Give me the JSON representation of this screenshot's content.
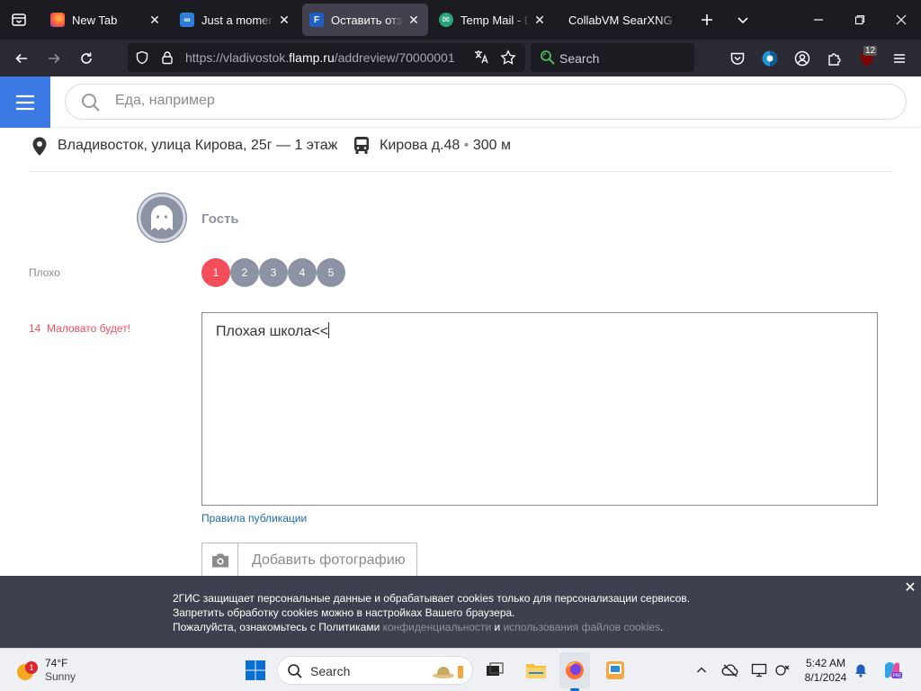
{
  "browser": {
    "tabs": [
      {
        "title": "New Tab",
        "favicon": "firefox-icon"
      },
      {
        "title": "Just a moment...",
        "favicon": "link-icon"
      },
      {
        "title": "Оставить отзыв",
        "favicon": "flamp-icon"
      },
      {
        "title": "Temp Mail - Disposable",
        "favicon": "tempmail-icon"
      },
      {
        "title": "CollabVM SearXNG",
        "favicon": ""
      }
    ],
    "url": {
      "prefix": "https://vladivostok.",
      "host": "flamp.ru",
      "path": "/addreview/70000001"
    },
    "search_placeholder": "Search",
    "extension_badge": "12"
  },
  "site": {
    "search_placeholder": "Еда, например",
    "address": "Владивосток, улица Кирова, 25г — 1 этаж",
    "transit_stop": "Кирова д.48",
    "transit_separator": "•",
    "transit_distance": "300 м",
    "user_name": "Гость",
    "rating_label": "Плохо",
    "rating_values": [
      "1",
      "2",
      "3",
      "4",
      "5"
    ],
    "rating_selected": 1,
    "char_count": "14",
    "char_warning": "Маловато будет!",
    "review_text": "Плохая школа<<",
    "rules_link": "Правила публикации",
    "add_photo": "Добавить фотографию"
  },
  "cookie_banner": {
    "line1": "2ГИС защищает персональные данные и обрабатывает cookies только для персонализации сервисов.",
    "line2": "Запретить обработку cookies можно в настройках Вашего браузера.",
    "line3_start": "Пожалуйста, ознакомьтесь с Политиками",
    "link1": "конфиденциальности",
    "conj": "и",
    "link2": "использования файлов cookies",
    "end": "."
  },
  "taskbar": {
    "weather_temp": "74°F",
    "weather_desc": "Sunny",
    "weather_badge": "1",
    "search_label": "Search",
    "time": "5:42 AM",
    "date": "8/1/2024"
  },
  "colors": {
    "accent_blue": "#3b79e4",
    "rating_red": "#f54d5a",
    "rating_grey": "#8b93a5",
    "link_blue": "#1e6bb8",
    "cookie_bg": "#3c414d"
  }
}
